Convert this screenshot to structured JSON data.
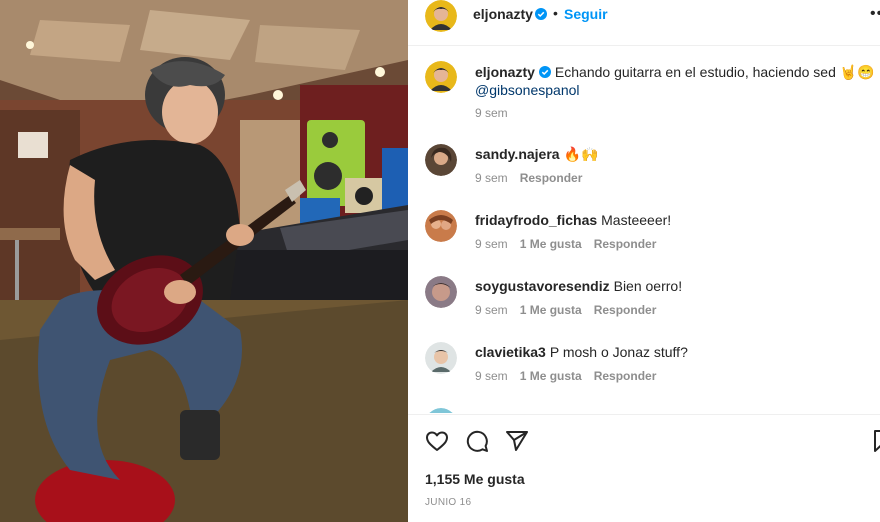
{
  "post": {
    "username": "eljonazty",
    "dot": "•",
    "follow_label": "Seguir",
    "more_label": "•••",
    "caption_text": "Echando guitarra en el estudio, haciendo sed 🤘😁",
    "caption_mention": "@gibsonespanol",
    "caption_time": "9 sem",
    "likes": "1,155 Me gusta",
    "date": "JUNIO 16"
  },
  "comments": [
    {
      "username": "sandy.najera",
      "text": "🔥🙌",
      "time": "9 sem",
      "likes": "",
      "reply": "Responder"
    },
    {
      "username": "fridayfrodo_fichas",
      "text": "Masteeeer!",
      "time": "9 sem",
      "likes": "1 Me gusta",
      "reply": "Responder"
    },
    {
      "username": "soygustavoresendiz",
      "text": "Bien oerro!",
      "time": "9 sem",
      "likes": "1 Me gusta",
      "reply": "Responder"
    },
    {
      "username": "clavietika3",
      "text": "P mosh o Jonaz stuff?",
      "time": "9 sem",
      "likes": "1 Me gusta",
      "reply": "Responder"
    }
  ],
  "colors": {
    "accent": "#0095f6",
    "verified": "#0095f6",
    "secondary_text": "#8e8e8e",
    "mention": "#00376b"
  },
  "icons": [
    "heart-icon",
    "comment-icon",
    "share-icon",
    "bookmark-icon",
    "verified-badge-icon",
    "more-icon"
  ]
}
